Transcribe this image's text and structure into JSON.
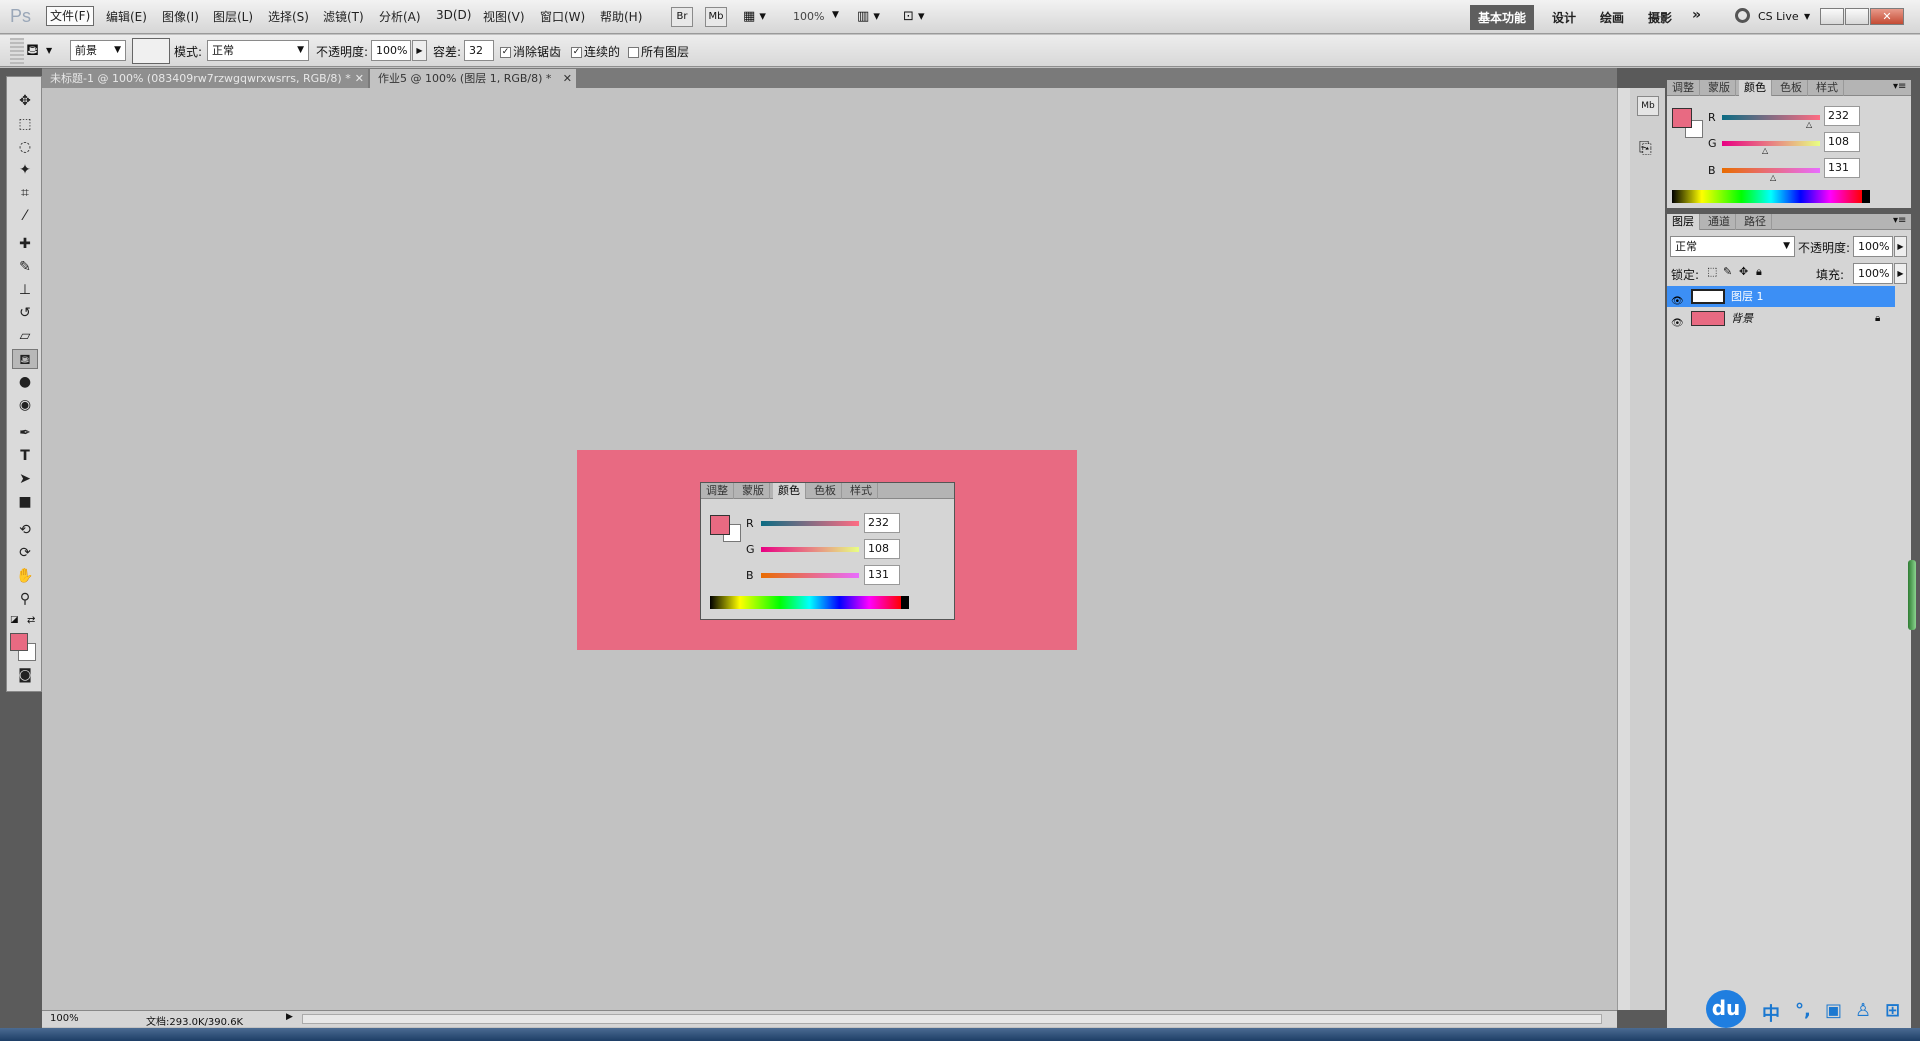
{
  "app": {
    "logo": "Ps"
  },
  "menu": [
    "文件(F)",
    "编辑(E)",
    "图像(I)",
    "图层(L)",
    "选择(S)",
    "滤镜(T)",
    "分析(A)",
    "3D(D)",
    "视图(V)",
    "窗口(W)",
    "帮助(H)"
  ],
  "appbar": {
    "bridge": "Br",
    "minibridge": "Mb",
    "zoom": "100%"
  },
  "workspaces": [
    "基本功能",
    "设计",
    "绘画",
    "摄影"
  ],
  "more_ws": "»",
  "cslive": "CS Live",
  "options": {
    "fill_source": "前景",
    "mode_label": "模式:",
    "mode_value": "正常",
    "opacity_label": "不透明度:",
    "opacity_value": "100%",
    "tolerance_label": "容差:",
    "tolerance_value": "32",
    "antialias": "消除锯齿",
    "contiguous": "连续的",
    "all_layers": "所有图层"
  },
  "doc_tabs": [
    "未标题-1 @ 100% (083409rw7rzwgqwrxwsrrs, RGB/8) *",
    "作业5 @ 100% (图层 1, RGB/8) *"
  ],
  "panel_tabs": [
    "调整",
    "蒙版",
    "颜色",
    "色板",
    "样式"
  ],
  "layers_tabs": [
    "图层",
    "通道",
    "路径"
  ],
  "color": {
    "r": "232",
    "g": "108",
    "b": "131",
    "fg_hex": "#e86a82"
  },
  "layers": {
    "blend": "正常",
    "opacity_label": "不透明度:",
    "opacity_value": "100%",
    "lock_label": "锁定:",
    "fill_label": "填充:",
    "fill_value": "100%",
    "items": [
      {
        "name": "图层 1"
      },
      {
        "name": "背景"
      }
    ]
  },
  "status": {
    "zoom": "100%",
    "doc": "文档:293.0K/390.6K"
  },
  "tray": {
    "ime_logo": "du",
    "ime_lang": "中"
  }
}
